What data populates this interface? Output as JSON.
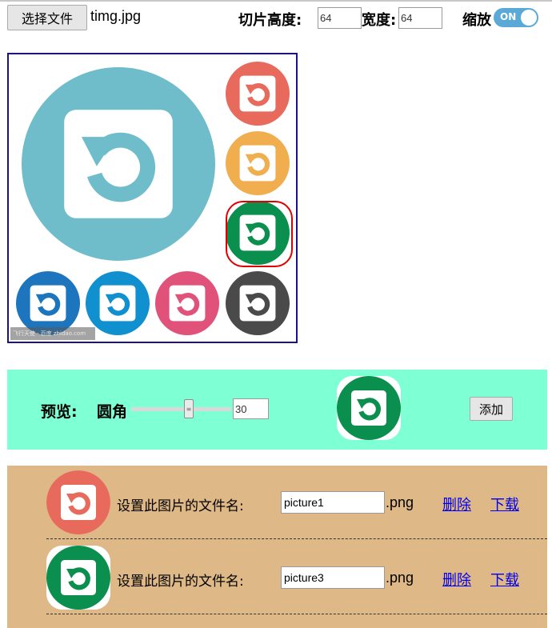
{
  "toolbar": {
    "file_button_label": "选择文件",
    "file_name": "timg.jpg",
    "slice_height_label": "切片高度:",
    "slice_height_value": "64",
    "width_label": "宽度:",
    "width_value": "64",
    "zoom_label": "缩放",
    "zoom_toggle_text": "ON",
    "zoom_enabled": true
  },
  "sprite": {
    "watermark_text": "飞行天使 · 百度 zhidao.com",
    "icon_name": "undo-icon",
    "tiles": [
      {
        "name": "big-teal",
        "color": "#6fbccb"
      },
      {
        "name": "red",
        "color": "#e86a5c"
      },
      {
        "name": "orange",
        "color": "#f0ae4e"
      },
      {
        "name": "green",
        "color": "#0a8f4e"
      },
      {
        "name": "blue",
        "color": "#1c75bd"
      },
      {
        "name": "lightblue",
        "color": "#1090cf"
      },
      {
        "name": "pink",
        "color": "#e0527a"
      },
      {
        "name": "dark",
        "color": "#4a4a4a"
      }
    ],
    "selected_tile": "green"
  },
  "preview": {
    "label": "预览:",
    "radius_label": "圆角",
    "radius_value": "30",
    "add_button_label": "添加",
    "thumb_color": "#0a8f4e"
  },
  "list": {
    "items": [
      {
        "thumb_color": "#e86a5c",
        "label": "设置此图片的文件名:",
        "filename": "picture1",
        "ext": ".png",
        "delete_label": "删除",
        "download_label": "下载"
      },
      {
        "thumb_color": "#0a8f4e",
        "label": "设置此图片的文件名:",
        "filename": "picture3",
        "ext": ".png",
        "delete_label": "删除",
        "download_label": "下载"
      }
    ]
  },
  "colors": {
    "preview_bg": "#7fffd4",
    "list_bg": "#deb887",
    "selection": "#e00000",
    "sprite_border": "#1a1380",
    "toggle_on": "#5aa9d6"
  }
}
